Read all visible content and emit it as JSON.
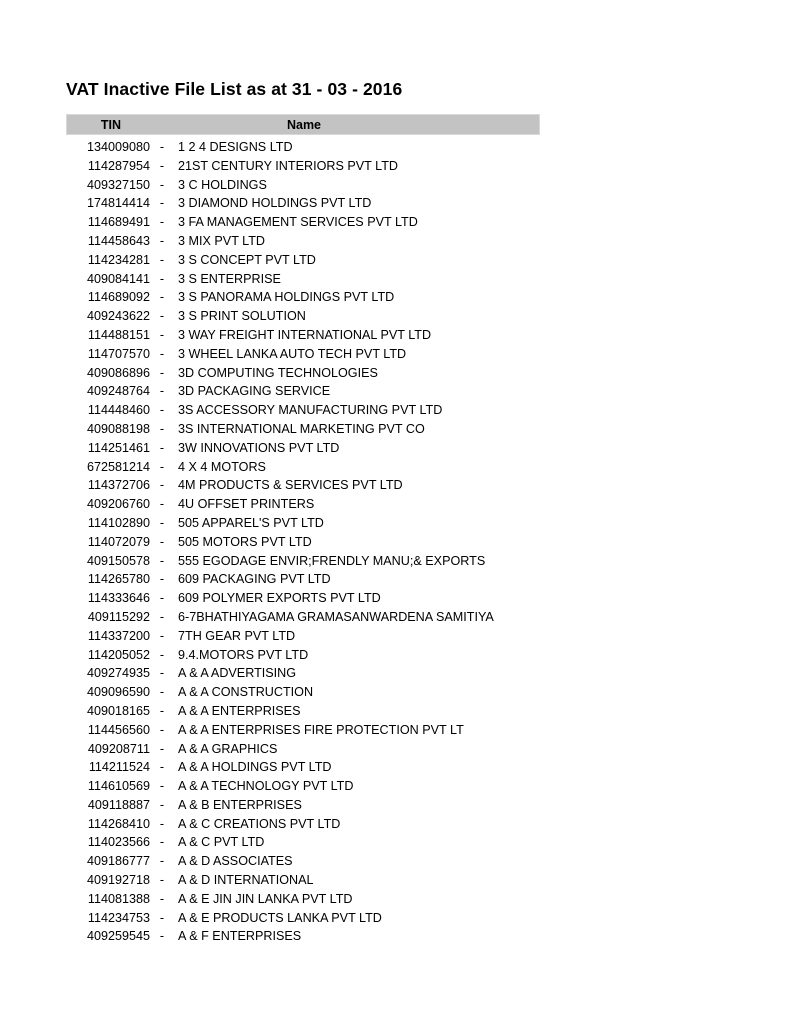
{
  "document": {
    "title": "VAT Inactive File List as at 31 - 03 - 2016"
  },
  "table": {
    "headers": {
      "tin": "TIN",
      "name": "Name"
    },
    "separator": "-",
    "header_background": "#c3c3c3",
    "rows": [
      {
        "tin": "134009080",
        "sep": "-",
        "name": "1 2 4 DESIGNS LTD"
      },
      {
        "tin": "114287954",
        "sep": "-",
        "name": "21ST CENTURY INTERIORS PVT LTD"
      },
      {
        "tin": "409327150",
        "sep": "-",
        "name": "3 C HOLDINGS"
      },
      {
        "tin": "174814414",
        "sep": "-",
        "name": "3 DIAMOND HOLDINGS PVT LTD"
      },
      {
        "tin": "114689491",
        "sep": "-",
        "name": "3 FA MANAGEMENT SERVICES PVT LTD"
      },
      {
        "tin": "114458643",
        "sep": "-",
        "name": "3 MIX PVT LTD"
      },
      {
        "tin": "114234281",
        "sep": "-",
        "name": "3 S CONCEPT PVT LTD"
      },
      {
        "tin": "409084141",
        "sep": "-",
        "name": "3 S ENTERPRISE"
      },
      {
        "tin": "114689092",
        "sep": "-",
        "name": "3 S PANORAMA HOLDINGS PVT LTD"
      },
      {
        "tin": "409243622",
        "sep": "-",
        "name": "3 S PRINT SOLUTION"
      },
      {
        "tin": "114488151",
        "sep": "-",
        "name": "3 WAY FREIGHT INTERNATIONAL PVT LTD"
      },
      {
        "tin": "114707570",
        "sep": "-",
        "name": "3 WHEEL LANKA AUTO TECH PVT LTD"
      },
      {
        "tin": "409086896",
        "sep": "-",
        "name": "3D COMPUTING TECHNOLOGIES"
      },
      {
        "tin": "409248764",
        "sep": "-",
        "name": "3D PACKAGING SERVICE"
      },
      {
        "tin": "114448460",
        "sep": "-",
        "name": "3S ACCESSORY MANUFACTURING PVT LTD"
      },
      {
        "tin": "409088198",
        "sep": "-",
        "name": "3S INTERNATIONAL MARKETING PVT CO"
      },
      {
        "tin": "114251461",
        "sep": "-",
        "name": "3W INNOVATIONS PVT LTD"
      },
      {
        "tin": "672581214",
        "sep": "-",
        "name": "4 X 4 MOTORS"
      },
      {
        "tin": "114372706",
        "sep": "-",
        "name": "4M PRODUCTS & SERVICES PVT LTD"
      },
      {
        "tin": "409206760",
        "sep": "-",
        "name": "4U OFFSET PRINTERS"
      },
      {
        "tin": "114102890",
        "sep": "-",
        "name": "505 APPAREL'S PVT LTD"
      },
      {
        "tin": "114072079",
        "sep": "-",
        "name": "505 MOTORS PVT LTD"
      },
      {
        "tin": "409150578",
        "sep": "-",
        "name": "555 EGODAGE ENVIR;FRENDLY MANU;& EXPORTS"
      },
      {
        "tin": "114265780",
        "sep": "-",
        "name": "609 PACKAGING PVT LTD"
      },
      {
        "tin": "114333646",
        "sep": "-",
        "name": "609 POLYMER EXPORTS PVT LTD"
      },
      {
        "tin": "409115292",
        "sep": "-",
        "name": "6-7BHATHIYAGAMA GRAMASANWARDENA SAMITIYA"
      },
      {
        "tin": "114337200",
        "sep": "-",
        "name": "7TH GEAR PVT LTD"
      },
      {
        "tin": "114205052",
        "sep": "-",
        "name": "9.4.MOTORS PVT LTD"
      },
      {
        "tin": "409274935",
        "sep": "-",
        "name": "A & A ADVERTISING"
      },
      {
        "tin": "409096590",
        "sep": "-",
        "name": "A & A CONSTRUCTION"
      },
      {
        "tin": "409018165",
        "sep": "-",
        "name": "A & A ENTERPRISES"
      },
      {
        "tin": "114456560",
        "sep": "-",
        "name": "A & A ENTERPRISES FIRE PROTECTION PVT LT"
      },
      {
        "tin": "409208711",
        "sep": "-",
        "name": "A & A GRAPHICS"
      },
      {
        "tin": "114211524",
        "sep": "-",
        "name": "A & A HOLDINGS PVT LTD"
      },
      {
        "tin": "114610569",
        "sep": "-",
        "name": "A & A TECHNOLOGY PVT LTD"
      },
      {
        "tin": "409118887",
        "sep": "-",
        "name": "A & B ENTERPRISES"
      },
      {
        "tin": "114268410",
        "sep": "-",
        "name": "A & C CREATIONS PVT LTD"
      },
      {
        "tin": "114023566",
        "sep": "-",
        "name": "A & C PVT LTD"
      },
      {
        "tin": "409186777",
        "sep": "-",
        "name": "A & D ASSOCIATES"
      },
      {
        "tin": "409192718",
        "sep": "-",
        "name": "A & D INTERNATIONAL"
      },
      {
        "tin": "114081388",
        "sep": "-",
        "name": "A & E JIN JIN LANKA PVT LTD"
      },
      {
        "tin": "114234753",
        "sep": "-",
        "name": "A & E PRODUCTS LANKA PVT LTD"
      },
      {
        "tin": "409259545",
        "sep": "-",
        "name": "A & F ENTERPRISES"
      }
    ]
  }
}
